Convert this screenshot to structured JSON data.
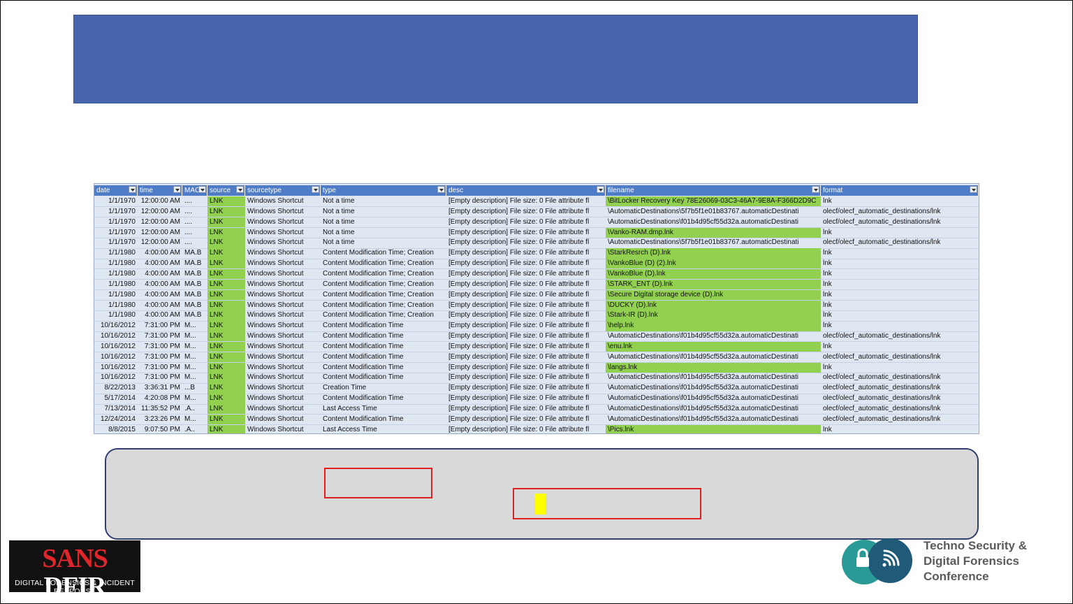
{
  "spreadsheet": {
    "headers": [
      "date",
      "time",
      "MAC",
      "source",
      "sourcetype",
      "type",
      "desc",
      "filename",
      "format"
    ],
    "rows": [
      [
        "1/1/1970",
        "12:00:00 AM",
        "....",
        "LNK",
        "Windows Shortcut",
        "Not a time",
        "[Empty description] File size: 0 File attribute fl",
        "\\BitLocker Recovery Key 78E26069-03C3-46A7-9E8A-F366D2D9C",
        "lnk"
      ],
      [
        "1/1/1970",
        "12:00:00 AM",
        "....",
        "LNK",
        "Windows Shortcut",
        "Not a time",
        "[Empty description] File size: 0 File attribute fl",
        "\\AutomaticDestinations\\5f7b5f1e01b83767.automaticDestinati",
        "olecf/olecf_automatic_destinations/lnk"
      ],
      [
        "1/1/1970",
        "12:00:00 AM",
        "....",
        "LNK",
        "Windows Shortcut",
        "Not a time",
        "[Empty description] File size: 0 File attribute fl",
        "\\AutomaticDestinations\\f01b4d95cf55d32a.automaticDestinati",
        "olecf/olecf_automatic_destinations/lnk"
      ],
      [
        "1/1/1970",
        "12:00:00 AM",
        "....",
        "LNK",
        "Windows Shortcut",
        "Not a time",
        "[Empty description] File size: 0 File attribute fl",
        "\\Vanko-RAM.dmp.lnk",
        "lnk"
      ],
      [
        "1/1/1970",
        "12:00:00 AM",
        "....",
        "LNK",
        "Windows Shortcut",
        "Not a time",
        "[Empty description] File size: 0 File attribute fl",
        "\\AutomaticDestinations\\5f7b5f1e01b83767.automaticDestinati",
        "olecf/olecf_automatic_destinations/lnk"
      ],
      [
        "1/1/1980",
        "4:00:00 AM",
        "MA.B",
        "LNK",
        "Windows Shortcut",
        "Content Modification Time; Creation",
        "[Empty description] File size: 0 File attribute fl",
        "\\StarkResrch (D).lnk",
        "lnk"
      ],
      [
        "1/1/1980",
        "4:00:00 AM",
        "MA.B",
        "LNK",
        "Windows Shortcut",
        "Content Modification Time; Creation",
        "[Empty description] File size: 0 File attribute fl",
        "\\VankoBlue (D) (2).lnk",
        "lnk"
      ],
      [
        "1/1/1980",
        "4:00:00 AM",
        "MA.B",
        "LNK",
        "Windows Shortcut",
        "Content Modification Time; Creation",
        "[Empty description] File size: 0 File attribute fl",
        "\\VankoBlue (D).lnk",
        "lnk"
      ],
      [
        "1/1/1980",
        "4:00:00 AM",
        "MA.B",
        "LNK",
        "Windows Shortcut",
        "Content Modification Time; Creation",
        "[Empty description] File size: 0 File attribute fl",
        "\\STARK_ENT (D).lnk",
        "lnk"
      ],
      [
        "1/1/1980",
        "4:00:00 AM",
        "MA.B",
        "LNK",
        "Windows Shortcut",
        "Content Modification Time; Creation",
        "[Empty description] File size: 0 File attribute fl",
        "\\Secure Digital storage device (D).lnk",
        "lnk"
      ],
      [
        "1/1/1980",
        "4:00:00 AM",
        "MA.B",
        "LNK",
        "Windows Shortcut",
        "Content Modification Time; Creation",
        "[Empty description] File size: 0 File attribute fl",
        "\\DUCKY (D).lnk",
        "lnk"
      ],
      [
        "1/1/1980",
        "4:00:00 AM",
        "MA.B",
        "LNK",
        "Windows Shortcut",
        "Content Modification Time; Creation",
        "[Empty description] File size: 0 File attribute fl",
        "\\Stark-IR (D).lnk",
        "lnk"
      ],
      [
        "10/16/2012",
        "7:31:00 PM",
        "M...",
        "LNK",
        "Windows Shortcut",
        "Content Modification Time",
        "[Empty description] File size: 0 File attribute fl",
        "\\help.lnk",
        "lnk"
      ],
      [
        "10/16/2012",
        "7:31:00 PM",
        "M...",
        "LNK",
        "Windows Shortcut",
        "Content Modification Time",
        "[Empty description] File size: 0 File attribute fl",
        "\\AutomaticDestinations\\f01b4d95cf55d32a.automaticDestinati",
        "olecf/olecf_automatic_destinations/lnk"
      ],
      [
        "10/16/2012",
        "7:31:00 PM",
        "M...",
        "LNK",
        "Windows Shortcut",
        "Content Modification Time",
        "[Empty description] File size: 0 File attribute fl",
        "\\enu.lnk",
        "lnk"
      ],
      [
        "10/16/2012",
        "7:31:00 PM",
        "M...",
        "LNK",
        "Windows Shortcut",
        "Content Modification Time",
        "[Empty description] File size: 0 File attribute fl",
        "\\AutomaticDestinations\\f01b4d95cf55d32a.automaticDestinati",
        "olecf/olecf_automatic_destinations/lnk"
      ],
      [
        "10/16/2012",
        "7:31:00 PM",
        "M...",
        "LNK",
        "Windows Shortcut",
        "Content Modification Time",
        "[Empty description] File size: 0 File attribute fl",
        "\\langs.lnk",
        "lnk"
      ],
      [
        "10/16/2012",
        "7:31:00 PM",
        "M...",
        "LNK",
        "Windows Shortcut",
        "Content Modification Time",
        "[Empty description] File size: 0 File attribute fl",
        "\\AutomaticDestinations\\f01b4d95cf55d32a.automaticDestinati",
        "olecf/olecf_automatic_destinations/lnk"
      ],
      [
        "8/22/2013",
        "3:36:31 PM",
        "...B",
        "LNK",
        "Windows Shortcut",
        "Creation Time",
        "[Empty description] File size: 0 File attribute fl",
        "\\AutomaticDestinations\\f01b4d95cf55d32a.automaticDestinati",
        "olecf/olecf_automatic_destinations/lnk"
      ],
      [
        "5/17/2014",
        "4:20:08 PM",
        "M...",
        "LNK",
        "Windows Shortcut",
        "Content Modification Time",
        "[Empty description] File size: 0 File attribute fl",
        "\\AutomaticDestinations\\f01b4d95cf55d32a.automaticDestinati",
        "olecf/olecf_automatic_destinations/lnk"
      ],
      [
        "7/13/2014",
        "11:35:52 PM",
        ".A..",
        "LNK",
        "Windows Shortcut",
        "Last Access Time",
        "[Empty description] File size: 0 File attribute fl",
        "\\AutomaticDestinations\\f01b4d95cf55d32a.automaticDestinati",
        "olecf/olecf_automatic_destinations/lnk"
      ],
      [
        "12/24/2014",
        "3:23:26 PM",
        "M...",
        "LNK",
        "Windows Shortcut",
        "Content Modification Time",
        "[Empty description] File size: 0 File attribute fl",
        "\\AutomaticDestinations\\f01b4d95cf55d32a.automaticDestinati",
        "olecf/olecf_automatic_destinations/lnk"
      ],
      [
        "8/8/2015",
        "9:07:50 PM",
        ".A..",
        "LNK",
        "Windows Shortcut",
        "Last Access Time",
        "[Empty description] File size: 0 File attribute fl",
        "\\Pics.lnk",
        "lnk"
      ]
    ],
    "highlight_color": "#92d050",
    "header_color": "#4f7cc6"
  },
  "logos": {
    "sans_word": "SANS",
    "dfir_word": "DFIR",
    "sans_tagline": "DIGITAL FORENSICS & INCIDENT RESPONSE",
    "tech_lines": [
      "Techno Security &",
      "Digital Forensics",
      "Conference"
    ],
    "tech_icons": [
      "lock-icon",
      "signal-icon"
    ]
  }
}
